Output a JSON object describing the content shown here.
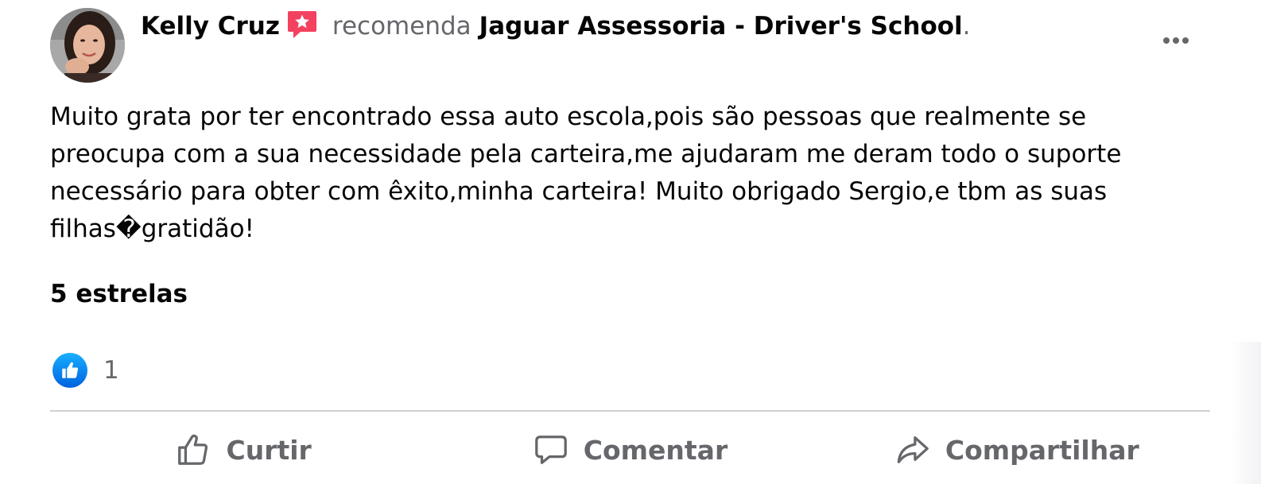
{
  "post": {
    "author": "Kelly Cruz",
    "recommend_icon": "recommend-star-icon",
    "verb": "recomenda",
    "page_name": "Jaguar Assessoria - Driver's School",
    "period": ".",
    "more_icon": "more-horizontal-icon",
    "review_text": "Muito grata por ter encontrado essa auto escola,pois são pessoas que realmente se preocupa com a sua necessidade pela carteira,me ajudaram me deram todo o suporte necessário para obter com êxito,minha carteira! Muito obrigado Sergio,e tbm as suas filhas�gratidão!",
    "rating": "5 estrelas"
  },
  "reactions": {
    "icon": "like-reaction-icon",
    "count": "1"
  },
  "actions": [
    {
      "label": "Curtir",
      "icon": "thumbs-up-icon"
    },
    {
      "label": "Comentar",
      "icon": "comment-icon"
    },
    {
      "label": "Compartilhar",
      "icon": "share-icon"
    }
  ],
  "colors": {
    "primary_text": "#050505",
    "secondary_text": "#65676b",
    "divider": "#ced0d4",
    "recommend_red": "#f3425f",
    "like_blue": "#0866ff"
  }
}
